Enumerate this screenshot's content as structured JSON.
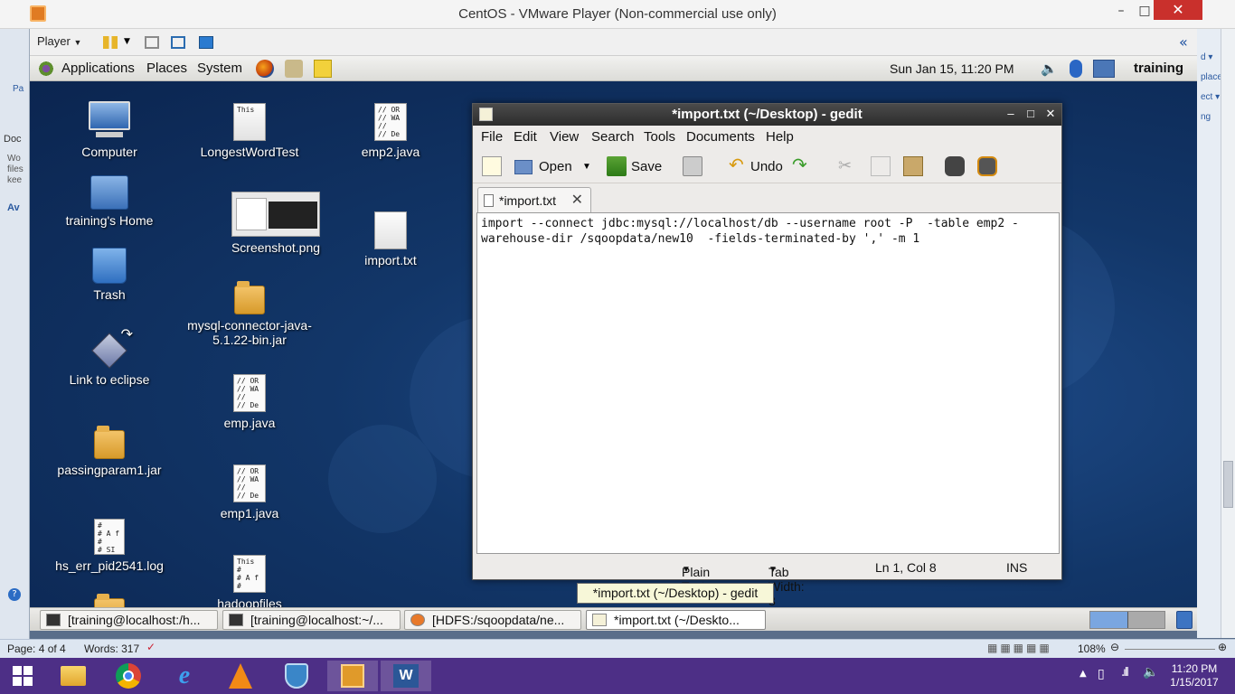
{
  "vmware": {
    "title": "CentOS - VMware Player (Non-commercial use only)",
    "player_label": "Player",
    "minimize": "–",
    "maximize": "□",
    "close": "✕",
    "collapse": "«"
  },
  "guest_panel": {
    "menus": [
      "Applications",
      "Places",
      "System"
    ],
    "clock": "Sun Jan 15, 11:20 PM",
    "user": "training"
  },
  "desktop_icons": {
    "computer": "Computer",
    "home": "training's Home",
    "trash": "Trash",
    "eclipse": "Link to eclipse",
    "passingparam": "passingparam1.jar",
    "hs_err": "hs_err_pid2541.log",
    "longestword": "LongestWordTest",
    "screenshot": "Screenshot.png",
    "mysql": "mysql-connector-java-5.1.22-bin.jar",
    "emp": "emp.java",
    "emp1": "emp1.java",
    "hadoopfiles": "hadoopfiles",
    "emp2": "emp2.java",
    "importtxt": "import.txt"
  },
  "gedit": {
    "title": "*import.txt (~/Desktop) - gedit",
    "menus": [
      "File",
      "Edit",
      "View",
      "Search",
      "Tools",
      "Documents",
      "Help"
    ],
    "toolbar": {
      "open": "Open",
      "save": "Save",
      "undo": "Undo"
    },
    "tab_label": "*import.txt",
    "content": "import --connect jdbc:mysql://localhost/db --username root -P  -table emp2 -\nwarehouse-dir /sqoopdata/new10  -fields-terminated-by ',' -m 1",
    "status": {
      "mode": "Plain Text",
      "tab_width": "Tab Width:  8",
      "position": "Ln 1, Col 8",
      "ins": "INS"
    }
  },
  "tooltip": "*import.txt (~/Desktop) - gedit",
  "guest_tasks": [
    "[training@localhost:/h...",
    "[training@localhost:~/...",
    "[HDFS:/sqoopdata/ne...",
    "*import.txt (~/Deskto..."
  ],
  "word_status": {
    "page": "Page: 4 of 4",
    "words": "Words: 317",
    "zoom": "108%"
  },
  "host_fragments": {
    "right": [
      "d ▾",
      "place",
      "ect ▾",
      "ng"
    ],
    "left": [
      "Pa",
      "Doc",
      "Wo",
      "files",
      "kee",
      "Av"
    ]
  },
  "win_clock": {
    "time": "11:20 PM",
    "date": "1/15/2017"
  },
  "colors": {
    "desktop": "#123668",
    "win_taskbar": "#4d2f86",
    "vm_close": "#c9302c"
  }
}
